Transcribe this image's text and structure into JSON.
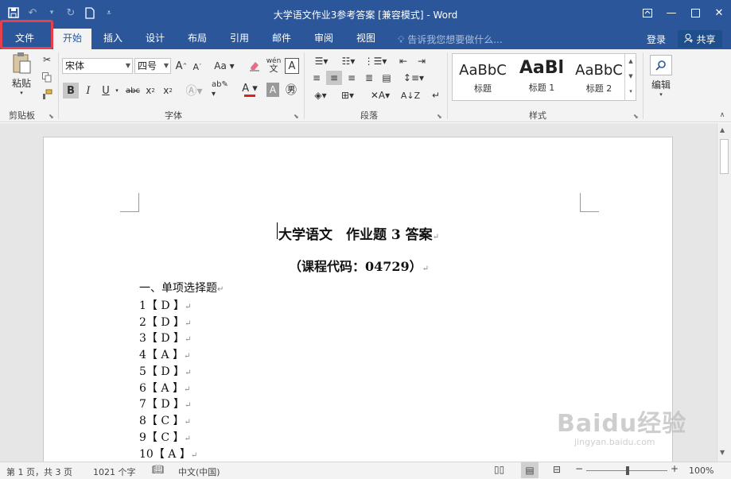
{
  "window": {
    "title": "大学语文作业3参考答案 [兼容模式] - Word"
  },
  "quick_access": {
    "undo": "↶",
    "redo": "↻"
  },
  "tabs": [
    {
      "label": "文件"
    },
    {
      "label": "开始"
    },
    {
      "label": "插入"
    },
    {
      "label": "设计"
    },
    {
      "label": "布局"
    },
    {
      "label": "引用"
    },
    {
      "label": "邮件"
    },
    {
      "label": "审阅"
    },
    {
      "label": "视图"
    }
  ],
  "tell_me": "告诉我您想要做什么...",
  "account": {
    "login": "登录",
    "share": "共享"
  },
  "ribbon": {
    "clipboard": {
      "label": "剪贴板",
      "paste": "粘贴"
    },
    "font": {
      "label": "字体",
      "font_name": "宋体",
      "font_size": "四号"
    },
    "paragraph": {
      "label": "段落"
    },
    "styles": {
      "label": "样式",
      "items": [
        {
          "sample": "AaBbC",
          "name": "标题"
        },
        {
          "sample": "AaBl",
          "name": "标题 1"
        },
        {
          "sample": "AaBbC",
          "name": "标题 2"
        }
      ]
    },
    "editing": {
      "label": "编辑"
    }
  },
  "document": {
    "title": "大学语文　作业题 3 答案",
    "subtitle": "（课程代码：04729）",
    "section": "一、单项选择题",
    "answers": [
      {
        "num": "1",
        "ans": "D"
      },
      {
        "num": "2",
        "ans": "D"
      },
      {
        "num": "3",
        "ans": "D"
      },
      {
        "num": "4",
        "ans": "A"
      },
      {
        "num": "5",
        "ans": "D"
      },
      {
        "num": "6",
        "ans": "A"
      },
      {
        "num": "7",
        "ans": "D"
      },
      {
        "num": "8",
        "ans": "C"
      },
      {
        "num": "9",
        "ans": "C"
      },
      {
        "num": "10",
        "ans": "A"
      }
    ],
    "para_mark": "↵"
  },
  "status": {
    "page": "第 1 页，共 3 页",
    "words": "1021 个字",
    "language": "中文(中国)",
    "zoom": "100%"
  },
  "watermark": {
    "brand": "Baidu经验",
    "url": "jingyan.baidu.com"
  }
}
